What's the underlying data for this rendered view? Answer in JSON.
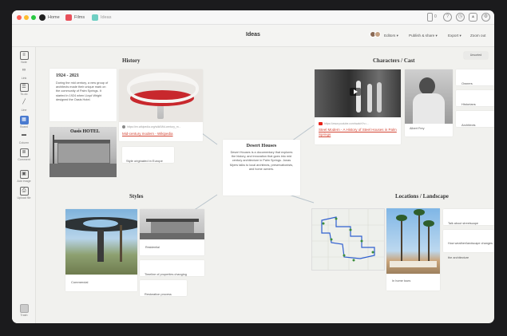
{
  "window": {
    "tabs": [
      {
        "label": "Home"
      },
      {
        "label": "Films"
      },
      {
        "label": "Ideas"
      }
    ],
    "traffic_lights": [
      "#fe5f57",
      "#febc2e",
      "#28c840"
    ]
  },
  "toolbar": {
    "title": "Ideas",
    "editors": "Editors",
    "publish": "Publish & share",
    "export": "Export",
    "zoom": "Zoom out",
    "notif_count": "0"
  },
  "sidebar": {
    "items": [
      {
        "icon": "note-icon",
        "label": "Note"
      },
      {
        "icon": "link-icon",
        "label": "Link"
      },
      {
        "icon": "todo-icon",
        "label": "To-do"
      },
      {
        "icon": "line-icon",
        "label": "Line"
      },
      {
        "icon": "board-icon",
        "label": "Board"
      },
      {
        "icon": "column-icon",
        "label": "Column"
      },
      {
        "icon": "comment-icon",
        "label": "Comment"
      },
      {
        "icon": "image-icon",
        "label": "Add image"
      },
      {
        "icon": "upload-icon",
        "label": "Upload file"
      },
      {
        "icon": "trash-icon",
        "label": "Trash"
      }
    ]
  },
  "canvas": {
    "unsorted": "Unsorted",
    "center": {
      "title": "Desert Houses",
      "text": "Desert Houses is a documentary that explores the history, and innovation that goes into mid century architecture in Palm Springs. Jonas Myers talks to local architects, preservationists, and home owners."
    },
    "history": {
      "title": "History",
      "years": "1924 - 2021",
      "text": "During the mid century, a new group of architects made their unique mark on the community of Palm Springs. It started in 1924 when Lloyd Wright designed the Oasis Hotel.",
      "chair_url": "https://en.wikipedia.org/wiki/Mid-century_m...",
      "chair_link": "Mid-century modern - Wikipedia",
      "hotel_sign": "Oasis HOTEL",
      "note": "Style originated in Europe"
    },
    "characters": {
      "title": "Characters / Cast",
      "video_url": "https://www.youtube.com/watch?v=...",
      "video_link": "Steel Modern - A History of Steel Houses in Palm Springs",
      "caption": "Albert Frey",
      "notes": [
        "Owners",
        "Historians",
        "Architects"
      ]
    },
    "styles": {
      "title": "Styles",
      "caption1": "Commercial",
      "caption2": "Residential",
      "notes": [
        "Timeline of properties changing",
        "Restoration process"
      ]
    },
    "locations": {
      "title": "Locations / Landscape",
      "caption": "In home tours",
      "notes": [
        "Talk about streetscape",
        "How weather/landscape changes the architecture"
      ]
    }
  }
}
